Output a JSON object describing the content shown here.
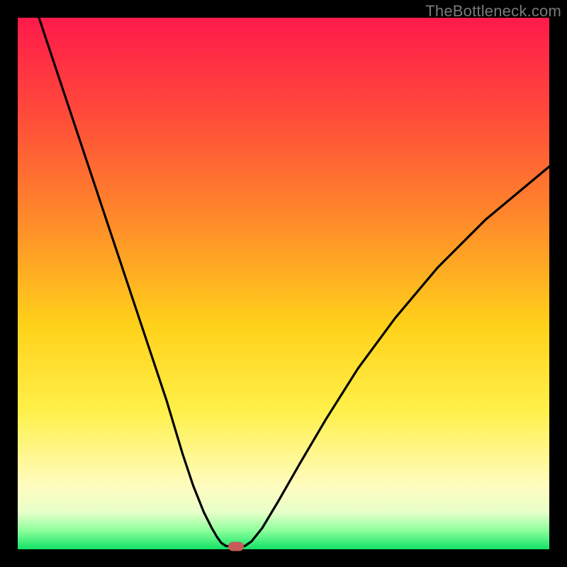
{
  "watermark": "TheBottleneck.com",
  "chart_data": {
    "type": "line",
    "title": "",
    "xlabel": "",
    "ylabel": "",
    "xlim": [
      0,
      100
    ],
    "ylim": [
      0,
      100
    ],
    "grid": false,
    "series": [
      {
        "name": "bottleneck-curve",
        "x": [
          4,
          8,
          12,
          16,
          20,
          24,
          28,
          31,
          33,
          35,
          36.5,
          37.5,
          38.3,
          39.2,
          42.7,
          44,
          46,
          49,
          53,
          58,
          64,
          71,
          79,
          88,
          100
        ],
        "values": [
          100,
          88,
          76,
          64,
          52,
          40,
          28,
          18,
          12,
          7,
          4,
          2.3,
          1.2,
          0.6,
          0.6,
          1.5,
          4,
          9,
          16,
          24.5,
          34,
          43.5,
          53,
          62,
          72
        ]
      }
    ],
    "marker": {
      "x": 41,
      "y": 0.6,
      "color": "#c85a5a"
    },
    "gradient_stops": [
      {
        "pos": 0,
        "color": "#ff1a4b"
      },
      {
        "pos": 0.18,
        "color": "#ff4a3a"
      },
      {
        "pos": 0.38,
        "color": "#ff8a2a"
      },
      {
        "pos": 0.58,
        "color": "#ffd21a"
      },
      {
        "pos": 0.74,
        "color": "#fff04a"
      },
      {
        "pos": 0.88,
        "color": "#fffcbf"
      },
      {
        "pos": 0.93,
        "color": "#e8ffca"
      },
      {
        "pos": 0.965,
        "color": "#8cff9c"
      },
      {
        "pos": 1.0,
        "color": "#12e266"
      }
    ]
  }
}
